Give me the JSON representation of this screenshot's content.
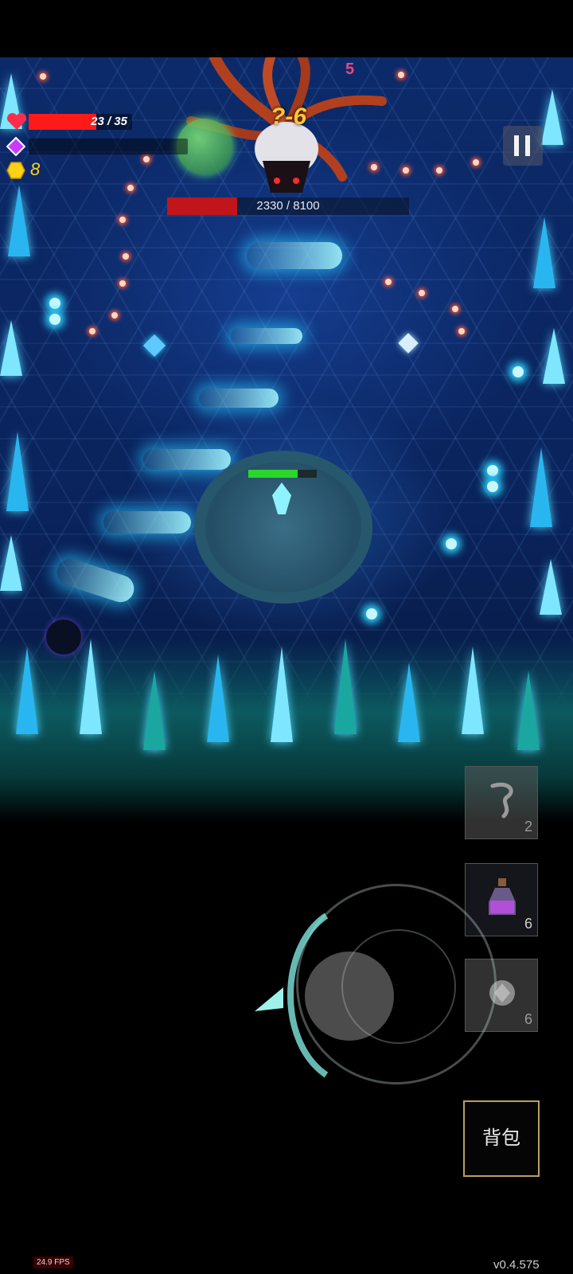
{
  "hud": {
    "hp_text": "23 / 35",
    "hp_ratio": 0.657,
    "mana_ratio": 0.0,
    "gold": "8",
    "level": "?-6",
    "damage_popup": "5"
  },
  "boss": {
    "hp_text": "2330 / 8100",
    "hp_ratio": 0.288
  },
  "items": [
    {
      "name": "scroll",
      "count": "2"
    },
    {
      "name": "potion",
      "count": "6"
    },
    {
      "name": "gem",
      "count": "6"
    }
  ],
  "backpack_label": "背包",
  "fps": "24.9 FPS",
  "version": "v0.4.575",
  "colors": {
    "hp": "#ff1a1a",
    "boss_hp": "#c0151a",
    "player_hp": "#2bd62b",
    "crystal": "#29b6f0"
  },
  "icons": [
    "heart-icon",
    "mana-gem-icon",
    "gold-coin-icon",
    "pause-icon",
    "scroll-icon",
    "potion-icon",
    "crystal-gem-icon"
  ]
}
